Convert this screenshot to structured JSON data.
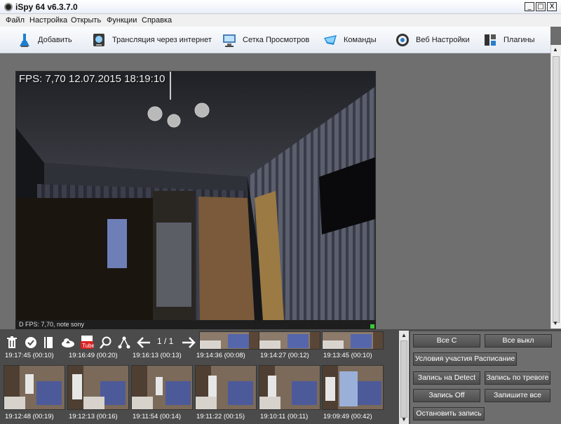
{
  "window": {
    "title": "iSpy 64 v6.3.7.0",
    "minimize": "_",
    "maximize": "□",
    "close": "X"
  },
  "menu": [
    "Файл",
    "Настройка",
    "Открыть",
    "Функции",
    "Справка"
  ],
  "toolbar": [
    {
      "label": "Добавить",
      "icon": "add-camera-icon"
    },
    {
      "label": "Трансляция через интернет",
      "icon": "broadcast-icon"
    },
    {
      "label": "Сетка Просмотров",
      "icon": "grid-view-icon"
    },
    {
      "label": "Команды",
      "icon": "commands-icon"
    },
    {
      "label": "Веб Настройки",
      "icon": "web-settings-icon"
    },
    {
      "label": "Плагины",
      "icon": "plugins-icon"
    }
  ],
  "camera": {
    "osd": "FPS: 7,70 12.07.2015 18:19:10",
    "status": "D  FPS: 7,70, note sony"
  },
  "media": {
    "page": "1 / 1",
    "row1": [
      "19:17:45 (00:10)",
      "19:16:49 (00:20)",
      "19:16:13 (00:13)",
      "19:14:36 (00:08)",
      "19:14:27 (00:12)",
      "19:13:45 (00:10)"
    ],
    "row2": [
      "19:12:48 (00:19)",
      "19:12:13 (00:16)",
      "19:11:54 (00:14)",
      "19:11:22 (00:15)",
      "19:10:11 (00:11)",
      "19:09:49 (00:42)"
    ]
  },
  "controls": {
    "all_on": "Все С",
    "all_off": "Все выкл",
    "schedule": "Условия участия Расписание",
    "record_detect": "Запись на Detect",
    "record_alarm": "Запись по тревоге",
    "record_off": "Запись Off",
    "record_all": "Запишите все",
    "stop_record": "Остановить запись"
  }
}
